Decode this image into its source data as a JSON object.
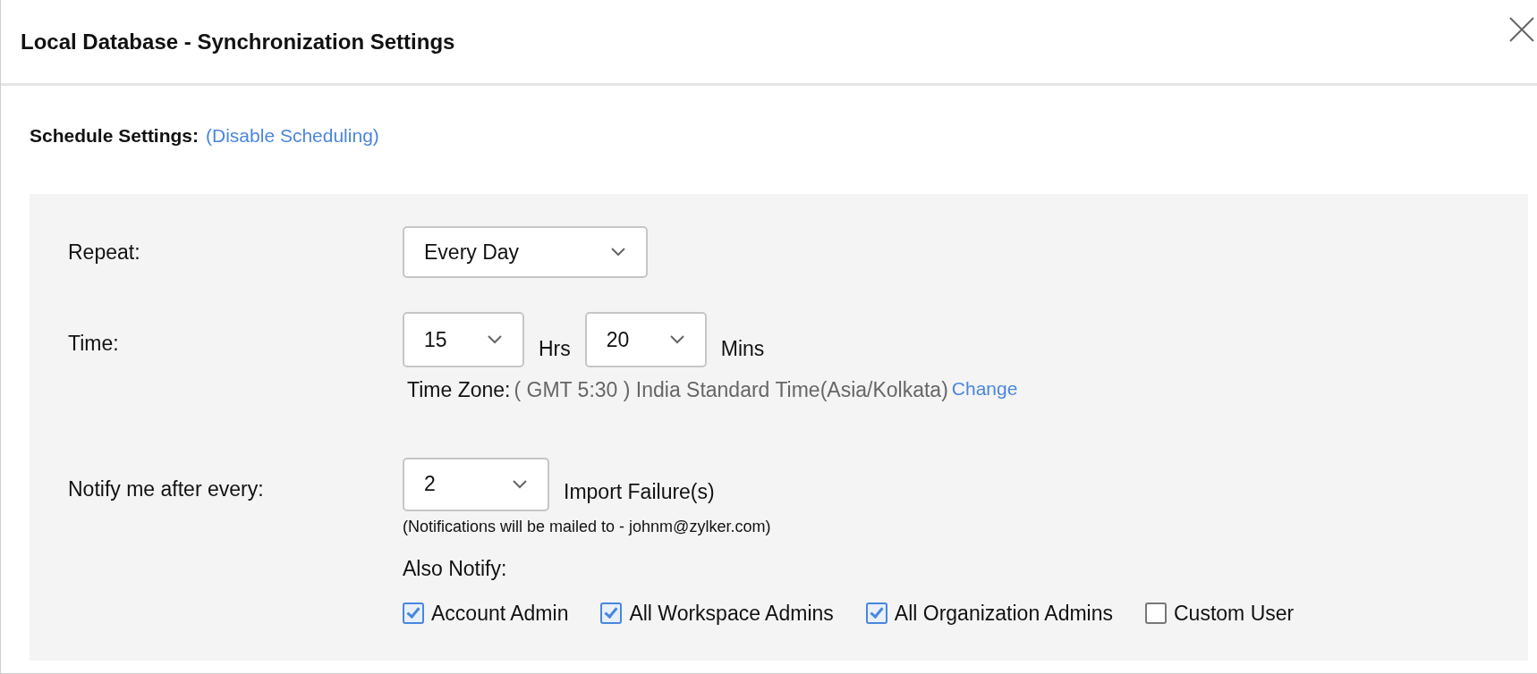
{
  "dialog": {
    "title": "Local Database - Synchronization Settings"
  },
  "schedule": {
    "label": "Schedule Settings:",
    "link": "(Disable Scheduling)"
  },
  "repeat": {
    "label": "Repeat:",
    "value": "Every Day"
  },
  "time": {
    "label": "Time:",
    "hours": "15",
    "hours_unit": "Hrs",
    "minutes": "20",
    "minutes_unit": "Mins",
    "zone_label": "Time Zone:",
    "zone_value": "( GMT 5:30 ) India Standard Time(Asia/Kolkata)",
    "zone_link": "Change"
  },
  "notify": {
    "label": "Notify me after every:",
    "value": "2",
    "unit": "Import Failure(s)",
    "note": "(Notifications will be mailed to - johnm@zylker.com)",
    "also_label": "Also Notify:",
    "options": [
      {
        "label": "Account Admin",
        "checked": true
      },
      {
        "label": "All Workspace Admins",
        "checked": true
      },
      {
        "label": "All Organization Admins",
        "checked": true
      },
      {
        "label": "Custom User",
        "checked": false
      }
    ]
  }
}
